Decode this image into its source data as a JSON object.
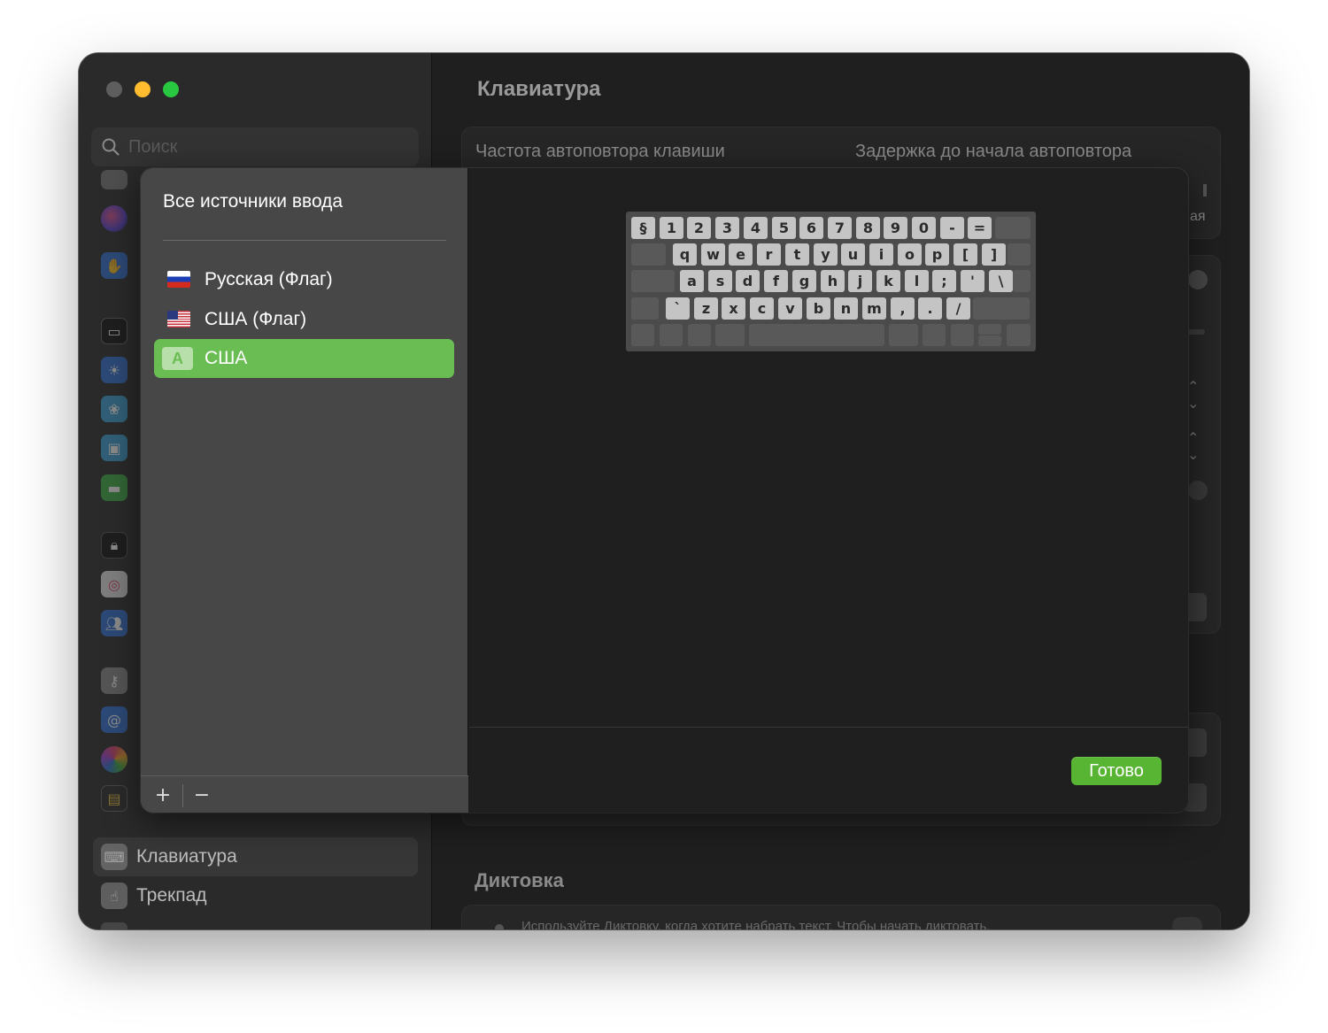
{
  "search": {
    "placeholder": "Поиск"
  },
  "sidebar": {
    "items": [
      {
        "label": "Клавиатура"
      },
      {
        "label": "Трекпад"
      }
    ]
  },
  "main": {
    "title": "Клавиатура",
    "key_repeat_rate": "Частота автоповтора клавиши",
    "delay_until_repeat": "Задержка до начала автоповтора",
    "partial_label": "ая",
    "dictation_title": "Диктовка",
    "dictation_text": "Используйте Диктовку, когда хотите набрать текст. Чтобы начать диктовать,"
  },
  "sheet": {
    "list_header": "Все источники ввода",
    "sources": [
      {
        "label": "Русская (Флаг)",
        "icon": "flag-russia-icon",
        "selected": false
      },
      {
        "label": "США (Флаг)",
        "icon": "flag-usa-icon",
        "selected": false
      },
      {
        "label": "США",
        "icon": "abc-input-icon",
        "badge": "A",
        "selected": true
      }
    ],
    "add_label": "+",
    "remove_label": "−",
    "done_label": "Готово",
    "selected_color": "#6abd52",
    "done_color": "#58b533"
  },
  "keyboard": {
    "rows": [
      [
        "§",
        "1",
        "2",
        "3",
        "4",
        "5",
        "6",
        "7",
        "8",
        "9",
        "0",
        "-",
        "="
      ],
      [
        "q",
        "w",
        "e",
        "r",
        "t",
        "y",
        "u",
        "i",
        "o",
        "p",
        "[",
        "]"
      ],
      [
        "a",
        "s",
        "d",
        "f",
        "g",
        "h",
        "j",
        "k",
        "l",
        ";",
        "'",
        "\\"
      ],
      [
        "`",
        "z",
        "x",
        "c",
        "v",
        "b",
        "n",
        "m",
        ",",
        ".",
        "/"
      ]
    ]
  }
}
